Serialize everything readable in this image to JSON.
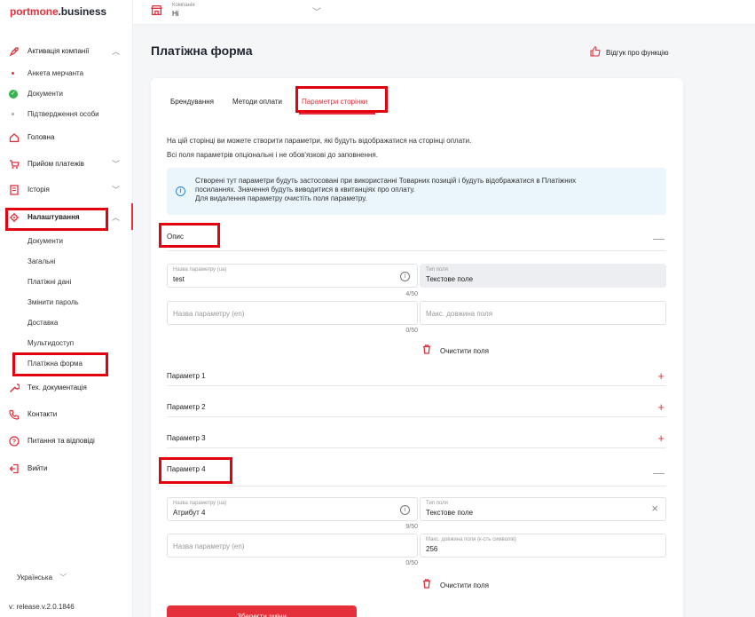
{
  "logo": {
    "part1": "portmone",
    "part2": ".business"
  },
  "company": {
    "caption": "Компанія",
    "value": "Hi"
  },
  "sidebar": {
    "activation": {
      "label": "Активація компанії",
      "chevron": "^"
    },
    "activation_items": [
      {
        "label": "Анкета мерчанта"
      },
      {
        "label": "Документи"
      },
      {
        "label": "Підтвердження особи"
      }
    ],
    "home": {
      "label": "Головна"
    },
    "payments": {
      "label": "Прийом платежів",
      "chevron": "v"
    },
    "history": {
      "label": "Історія",
      "chevron": "v"
    },
    "settings": {
      "label": "Налаштування",
      "chevron": "^"
    },
    "settings_items": [
      {
        "label": "Документи"
      },
      {
        "label": "Загальні"
      },
      {
        "label": "Платіжні дані"
      },
      {
        "label": "Змінити пароль"
      },
      {
        "label": "Доставка"
      },
      {
        "label": "Мультидоступ"
      },
      {
        "label": "Платіжна форма"
      }
    ],
    "techdocs": {
      "label": "Тех. документація"
    },
    "contacts": {
      "label": "Контакти"
    },
    "faq": {
      "label": "Питання та відповіді"
    },
    "logout": {
      "label": "Вийти"
    },
    "language": "Українська",
    "version": "v: release.v.2.0.1846"
  },
  "page": {
    "title": "Платіжна форма",
    "feedback": "Відгук про функцію"
  },
  "tabs": [
    {
      "label": "Брендування"
    },
    {
      "label": "Методи оплати"
    },
    {
      "label": "Параметри сторінки"
    }
  ],
  "description": {
    "line1": "На цій сторінці ви можете створити параметри, які будуть відображатися на сторінці оплати.",
    "line2": "Всі поля параметрів опціональні і не обов'язкові до заповнення."
  },
  "info": {
    "line1": "Створені тут параметри будуть застосовані при використанні Товарних позицій і будуть відображатися в Платіжних",
    "line2": "посиланнях. Значення будуть виводитися в квитанціях про оплату.",
    "line3": "Для видалення параметру очистіть поля параметру."
  },
  "opys": {
    "title": "Опис",
    "name_ua": {
      "caption": "Назва параметру (ua)",
      "value": "test",
      "counter": "4/50"
    },
    "type": {
      "caption": "Тип поля",
      "value": "Текстове поле"
    },
    "name_en": {
      "placeholder": "Назва параметру (en)",
      "counter": "0/50"
    },
    "max_len": {
      "placeholder": "Макс. довжина поля"
    },
    "clear": "Очистити поля"
  },
  "params": [
    {
      "title": "Параметр 1",
      "sign": "+"
    },
    {
      "title": "Параметр 2",
      "sign": "+"
    },
    {
      "title": "Параметр 3",
      "sign": "+"
    }
  ],
  "param4": {
    "title": "Параметр 4",
    "name_ua": {
      "caption": "Назва параметру (ua)",
      "value": "Атрибут 4",
      "counter": "9/50"
    },
    "type": {
      "caption": "Тип поля",
      "value": "Текстове поле"
    },
    "name_en": {
      "placeholder": "Назва параметру (en)",
      "counter": "0/50"
    },
    "max_len": {
      "caption": "Макс. довжина поля (к-сть символів)",
      "value": "256"
    },
    "clear": "Очистити поля"
  },
  "save_button": "Зберегти зміни",
  "colors": {
    "accent": "#e52f3a",
    "highlight": "#e3000f",
    "info_bg": "#eaf5fc"
  }
}
